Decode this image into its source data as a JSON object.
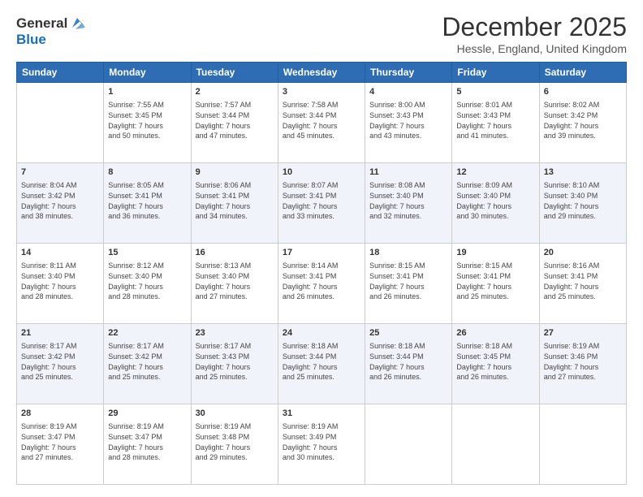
{
  "header": {
    "logo": {
      "line1": "General",
      "line2": "Blue"
    },
    "title": "December 2025",
    "location": "Hessle, England, United Kingdom"
  },
  "calendar": {
    "days": [
      "Sunday",
      "Monday",
      "Tuesday",
      "Wednesday",
      "Thursday",
      "Friday",
      "Saturday"
    ],
    "weeks": [
      [
        {
          "day": "",
          "content": ""
        },
        {
          "day": "1",
          "content": "Sunrise: 7:55 AM\nSunset: 3:45 PM\nDaylight: 7 hours\nand 50 minutes."
        },
        {
          "day": "2",
          "content": "Sunrise: 7:57 AM\nSunset: 3:44 PM\nDaylight: 7 hours\nand 47 minutes."
        },
        {
          "day": "3",
          "content": "Sunrise: 7:58 AM\nSunset: 3:44 PM\nDaylight: 7 hours\nand 45 minutes."
        },
        {
          "day": "4",
          "content": "Sunrise: 8:00 AM\nSunset: 3:43 PM\nDaylight: 7 hours\nand 43 minutes."
        },
        {
          "day": "5",
          "content": "Sunrise: 8:01 AM\nSunset: 3:43 PM\nDaylight: 7 hours\nand 41 minutes."
        },
        {
          "day": "6",
          "content": "Sunrise: 8:02 AM\nSunset: 3:42 PM\nDaylight: 7 hours\nand 39 minutes."
        }
      ],
      [
        {
          "day": "7",
          "content": "Sunrise: 8:04 AM\nSunset: 3:42 PM\nDaylight: 7 hours\nand 38 minutes."
        },
        {
          "day": "8",
          "content": "Sunrise: 8:05 AM\nSunset: 3:41 PM\nDaylight: 7 hours\nand 36 minutes."
        },
        {
          "day": "9",
          "content": "Sunrise: 8:06 AM\nSunset: 3:41 PM\nDaylight: 7 hours\nand 34 minutes."
        },
        {
          "day": "10",
          "content": "Sunrise: 8:07 AM\nSunset: 3:41 PM\nDaylight: 7 hours\nand 33 minutes."
        },
        {
          "day": "11",
          "content": "Sunrise: 8:08 AM\nSunset: 3:40 PM\nDaylight: 7 hours\nand 32 minutes."
        },
        {
          "day": "12",
          "content": "Sunrise: 8:09 AM\nSunset: 3:40 PM\nDaylight: 7 hours\nand 30 minutes."
        },
        {
          "day": "13",
          "content": "Sunrise: 8:10 AM\nSunset: 3:40 PM\nDaylight: 7 hours\nand 29 minutes."
        }
      ],
      [
        {
          "day": "14",
          "content": "Sunrise: 8:11 AM\nSunset: 3:40 PM\nDaylight: 7 hours\nand 28 minutes."
        },
        {
          "day": "15",
          "content": "Sunrise: 8:12 AM\nSunset: 3:40 PM\nDaylight: 7 hours\nand 28 minutes."
        },
        {
          "day": "16",
          "content": "Sunrise: 8:13 AM\nSunset: 3:40 PM\nDaylight: 7 hours\nand 27 minutes."
        },
        {
          "day": "17",
          "content": "Sunrise: 8:14 AM\nSunset: 3:41 PM\nDaylight: 7 hours\nand 26 minutes."
        },
        {
          "day": "18",
          "content": "Sunrise: 8:15 AM\nSunset: 3:41 PM\nDaylight: 7 hours\nand 26 minutes."
        },
        {
          "day": "19",
          "content": "Sunrise: 8:15 AM\nSunset: 3:41 PM\nDaylight: 7 hours\nand 25 minutes."
        },
        {
          "day": "20",
          "content": "Sunrise: 8:16 AM\nSunset: 3:41 PM\nDaylight: 7 hours\nand 25 minutes."
        }
      ],
      [
        {
          "day": "21",
          "content": "Sunrise: 8:17 AM\nSunset: 3:42 PM\nDaylight: 7 hours\nand 25 minutes."
        },
        {
          "day": "22",
          "content": "Sunrise: 8:17 AM\nSunset: 3:42 PM\nDaylight: 7 hours\nand 25 minutes."
        },
        {
          "day": "23",
          "content": "Sunrise: 8:17 AM\nSunset: 3:43 PM\nDaylight: 7 hours\nand 25 minutes."
        },
        {
          "day": "24",
          "content": "Sunrise: 8:18 AM\nSunset: 3:44 PM\nDaylight: 7 hours\nand 25 minutes."
        },
        {
          "day": "25",
          "content": "Sunrise: 8:18 AM\nSunset: 3:44 PM\nDaylight: 7 hours\nand 26 minutes."
        },
        {
          "day": "26",
          "content": "Sunrise: 8:18 AM\nSunset: 3:45 PM\nDaylight: 7 hours\nand 26 minutes."
        },
        {
          "day": "27",
          "content": "Sunrise: 8:19 AM\nSunset: 3:46 PM\nDaylight: 7 hours\nand 27 minutes."
        }
      ],
      [
        {
          "day": "28",
          "content": "Sunrise: 8:19 AM\nSunset: 3:47 PM\nDaylight: 7 hours\nand 27 minutes."
        },
        {
          "day": "29",
          "content": "Sunrise: 8:19 AM\nSunset: 3:47 PM\nDaylight: 7 hours\nand 28 minutes."
        },
        {
          "day": "30",
          "content": "Sunrise: 8:19 AM\nSunset: 3:48 PM\nDaylight: 7 hours\nand 29 minutes."
        },
        {
          "day": "31",
          "content": "Sunrise: 8:19 AM\nSunset: 3:49 PM\nDaylight: 7 hours\nand 30 minutes."
        },
        {
          "day": "",
          "content": ""
        },
        {
          "day": "",
          "content": ""
        },
        {
          "day": "",
          "content": ""
        }
      ]
    ]
  }
}
